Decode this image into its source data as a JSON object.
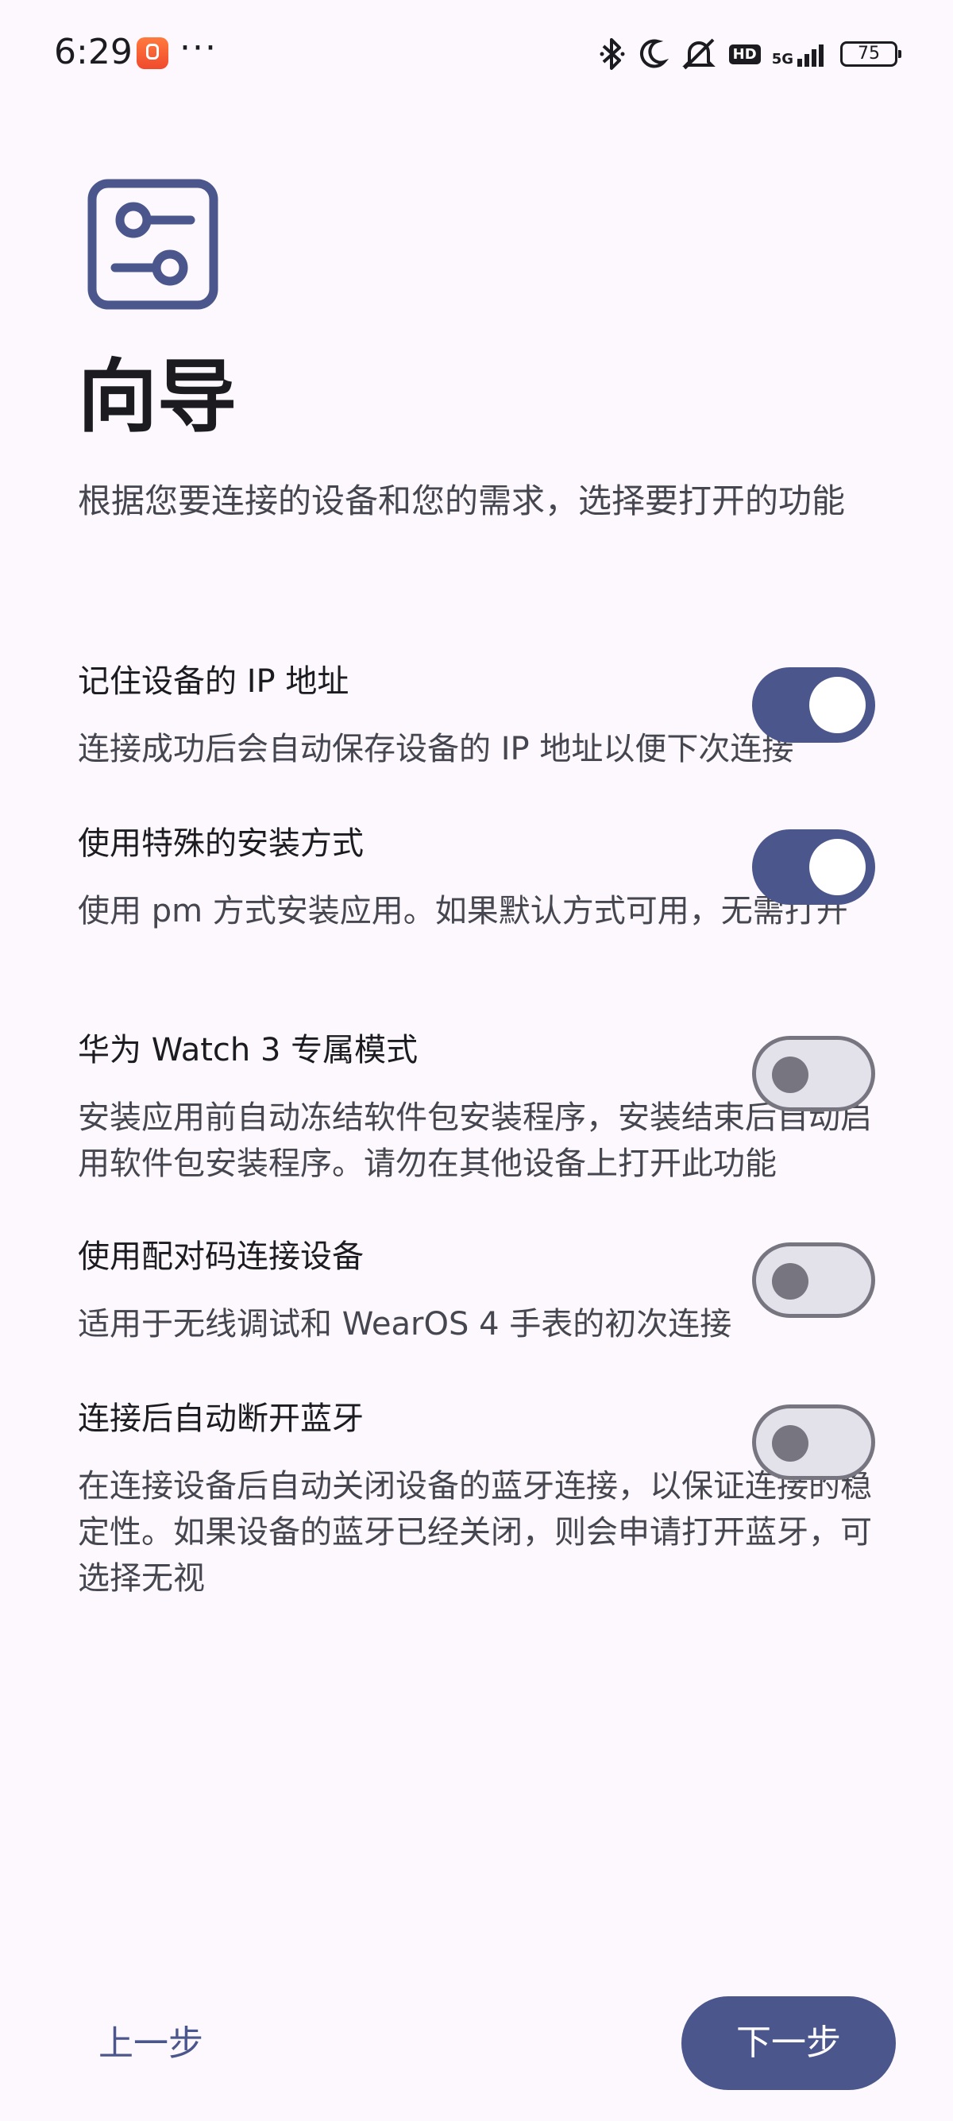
{
  "status_bar": {
    "time": "6:29",
    "more": "···",
    "network_label": "5G",
    "hd_label": "HD",
    "battery": "75",
    "icons": [
      "app-icon",
      "bluetooth-icon",
      "moon-icon",
      "bell-off-icon",
      "hd-icon",
      "signal-icon",
      "battery-icon"
    ]
  },
  "header": {
    "title": "向导",
    "description": "根据您要连接的设备和您的需求，选择要打开的功能"
  },
  "settings": [
    {
      "title": "记住设备的 IP 地址",
      "description": "连接成功后会自动保存设备的 IP 地址以便下次连接",
      "enabled": true
    },
    {
      "title": "使用特殊的安装方式",
      "description": "使用 pm 方式安装应用。如果默认方式可用，无需打开",
      "enabled": true
    },
    {
      "title": "华为 Watch 3 专属模式",
      "description": "安装应用前自动冻结软件包安装程序，安装结束后自动启用软件包安装程序。请勿在其他设备上打开此功能",
      "enabled": false
    },
    {
      "title": "使用配对码连接设备",
      "description": "适用于无线调试和 WearOS 4 手表的初次连接",
      "enabled": false
    },
    {
      "title": "连接后自动断开蓝牙",
      "description": "在连接设备后自动关闭设备的蓝牙连接，以保证连接的稳定性。如果设备的蓝牙已经关闭，则会申请打开蓝牙，可选择无视",
      "enabled": false
    }
  ],
  "footer": {
    "prev_label": "上一步",
    "next_label": "下一步"
  },
  "colors": {
    "accent": "#4b568c",
    "background": "#fcf8fd",
    "switch_off_track": "#e3e1e9",
    "switch_off_outline": "#777680"
  }
}
